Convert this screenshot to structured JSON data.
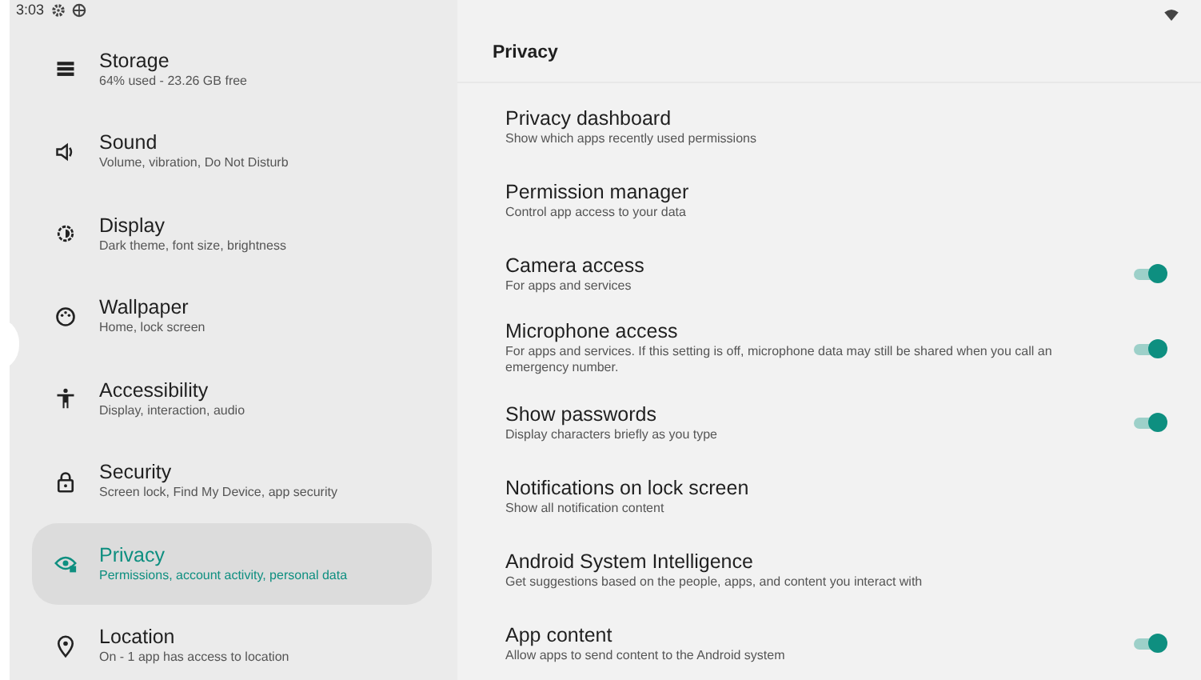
{
  "status_bar": {
    "time": "3:03"
  },
  "sidebar": {
    "items": [
      {
        "title": "Storage",
        "subtitle": "64% used - 23.26 GB free",
        "kind": "storage",
        "selected": false
      },
      {
        "title": "Sound",
        "subtitle": "Volume, vibration, Do Not Disturb",
        "kind": "sound",
        "selected": false
      },
      {
        "title": "Display",
        "subtitle": "Dark theme, font size, brightness",
        "kind": "display",
        "selected": false
      },
      {
        "title": "Wallpaper",
        "subtitle": "Home, lock screen",
        "kind": "wallpaper",
        "selected": false
      },
      {
        "title": "Accessibility",
        "subtitle": "Display, interaction, audio",
        "kind": "accessibility",
        "selected": false
      },
      {
        "title": "Security",
        "subtitle": "Screen lock, Find My Device, app security",
        "kind": "security",
        "selected": false
      },
      {
        "title": "Privacy",
        "subtitle": "Permissions, account activity, personal data",
        "kind": "privacy",
        "selected": true
      },
      {
        "title": "Location",
        "subtitle": "On - 1 app has access to location",
        "kind": "location",
        "selected": false
      }
    ]
  },
  "panel": {
    "title": "Privacy",
    "settings": [
      {
        "title": "Privacy dashboard",
        "subtitle": "Show which apps recently used permissions",
        "kind": "link"
      },
      {
        "title": "Permission manager",
        "subtitle": "Control app access to your data",
        "kind": "link"
      },
      {
        "title": "Camera access",
        "subtitle": "For apps and services",
        "kind": "switch",
        "on": true
      },
      {
        "title": "Microphone access",
        "subtitle": "For apps and services. If this setting is off, microphone data may still be shared when you call an emergency number.",
        "kind": "switch",
        "on": true
      },
      {
        "title": "Show passwords",
        "subtitle": "Display characters briefly as you type",
        "kind": "switch",
        "on": true
      },
      {
        "title": "Notifications on lock screen",
        "subtitle": "Show all notification content",
        "kind": "link"
      },
      {
        "title": "Android System Intelligence",
        "subtitle": "Get suggestions based on the people, apps, and content you interact with",
        "kind": "link"
      },
      {
        "title": "App content",
        "subtitle": "Allow apps to send content to the Android system",
        "kind": "switch",
        "on": true
      }
    ]
  }
}
